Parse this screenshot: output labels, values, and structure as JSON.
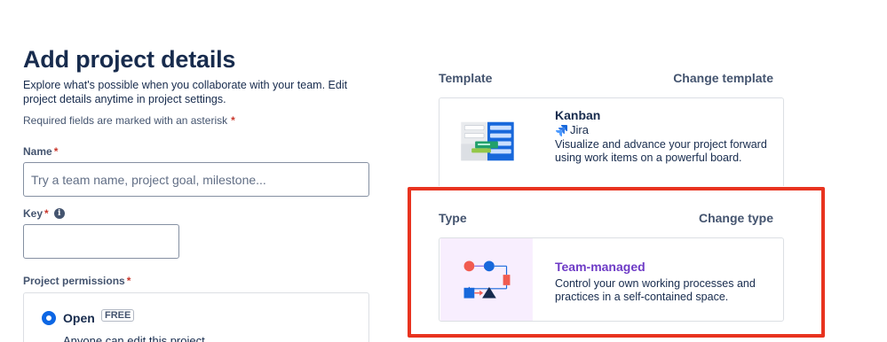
{
  "page": {
    "title": "Add project details",
    "subtitle": "Explore what's possible when you collaborate with your team. Edit project details anytime in project settings.",
    "required_note": "Required fields are marked with an asterisk",
    "asterisk": "*"
  },
  "form": {
    "name": {
      "label": "Name",
      "placeholder": "Try a team name, project goal, milestone...",
      "value": ""
    },
    "key": {
      "label": "Key",
      "value": ""
    },
    "permissions": {
      "label": "Project permissions",
      "selected_option": "Open",
      "badge": "FREE",
      "description": "Anyone can edit this project"
    }
  },
  "template": {
    "section_label": "Template",
    "change_label": "Change template",
    "name": "Kanban",
    "product": "Jira",
    "description": "Visualize and advance your project forward using work items on a powerful board."
  },
  "type": {
    "section_label": "Type",
    "change_label": "Change type",
    "name": "Team-managed",
    "description": "Control your own working processes and practices in a self-contained space."
  },
  "colors": {
    "accent_blue": "#0c66e4",
    "required_red": "#c9372c",
    "team_managed_purple": "#6e3bc6",
    "highlight_red": "#e8331f"
  }
}
